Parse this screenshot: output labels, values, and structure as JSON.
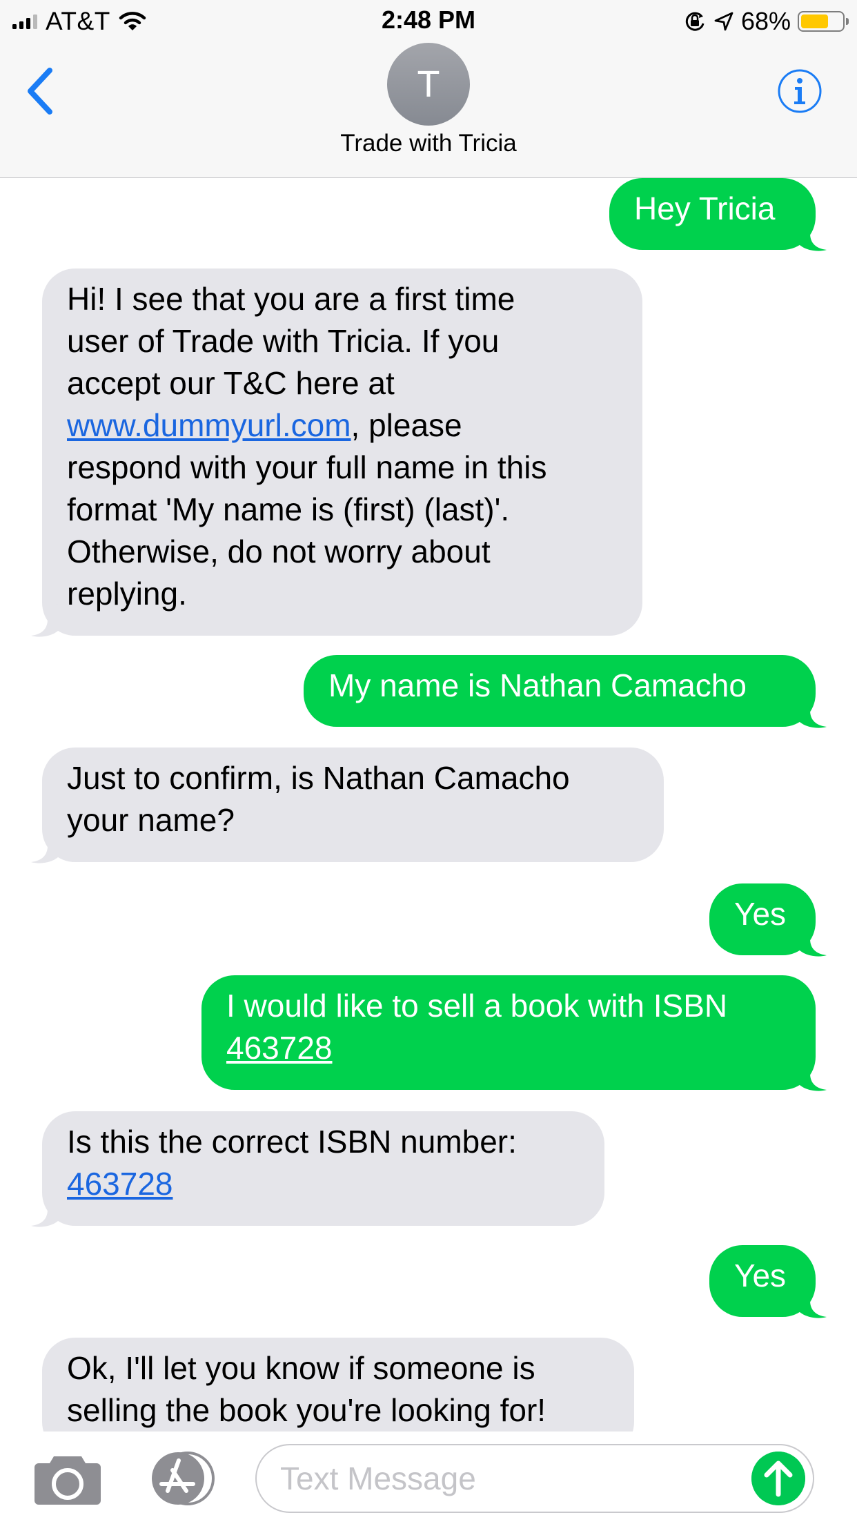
{
  "status_bar": {
    "carrier": "AT&T",
    "time": "2:48 PM",
    "battery_percent": "68%",
    "battery_level": 0.68,
    "battery_color": "#ffc800",
    "icons": [
      "signal-bars-icon",
      "wifi-icon",
      "orientation-lock-icon",
      "location-arrow-icon",
      "battery-icon"
    ]
  },
  "header": {
    "avatar_initial": "T",
    "contact_name": "Trade with Tricia",
    "back_icon": "chevron-left-icon",
    "info_icon": "info-icon"
  },
  "messages": [
    {
      "from": "me",
      "lines": [
        "Hey Tricia"
      ]
    },
    {
      "from": "them",
      "lines": [
        "Hi! I see that you are a first time",
        "user of Trade with Tricia. If you",
        "accept our T&C here at",
        "www.dummyurl.com, please",
        "respond with your full name in this",
        "format 'My name is (first) (last)'.",
        "Otherwise, do not worry about",
        "replying."
      ],
      "link": "www.dummyurl.com"
    },
    {
      "from": "me",
      "lines": [
        "My name is Nathan Camacho"
      ]
    },
    {
      "from": "them",
      "lines": [
        "Just to confirm, is Nathan Camacho",
        "your name?"
      ]
    },
    {
      "from": "me",
      "lines": [
        "Yes"
      ]
    },
    {
      "from": "me",
      "lines": [
        "I would like to sell a book with ISBN",
        "463728"
      ],
      "link": "463728"
    },
    {
      "from": "them",
      "lines": [
        "Is this the correct ISBN number:",
        "463728"
      ],
      "link": "463728"
    },
    {
      "from": "me",
      "lines": [
        "Yes"
      ]
    },
    {
      "from": "them",
      "lines": [
        "Ok, I'll let you know if someone is",
        "selling the book you're looking for!"
      ]
    }
  ],
  "composer": {
    "placeholder": "Text Message",
    "camera_icon": "camera-icon",
    "apps_icon": "app-store-icon",
    "send_icon": "send-arrow-icon"
  },
  "colors": {
    "sent_bubble": "#00d14d",
    "received_bubble": "#e5e5ea",
    "accent": "#1a7cf5",
    "link": "#1a66e0"
  }
}
